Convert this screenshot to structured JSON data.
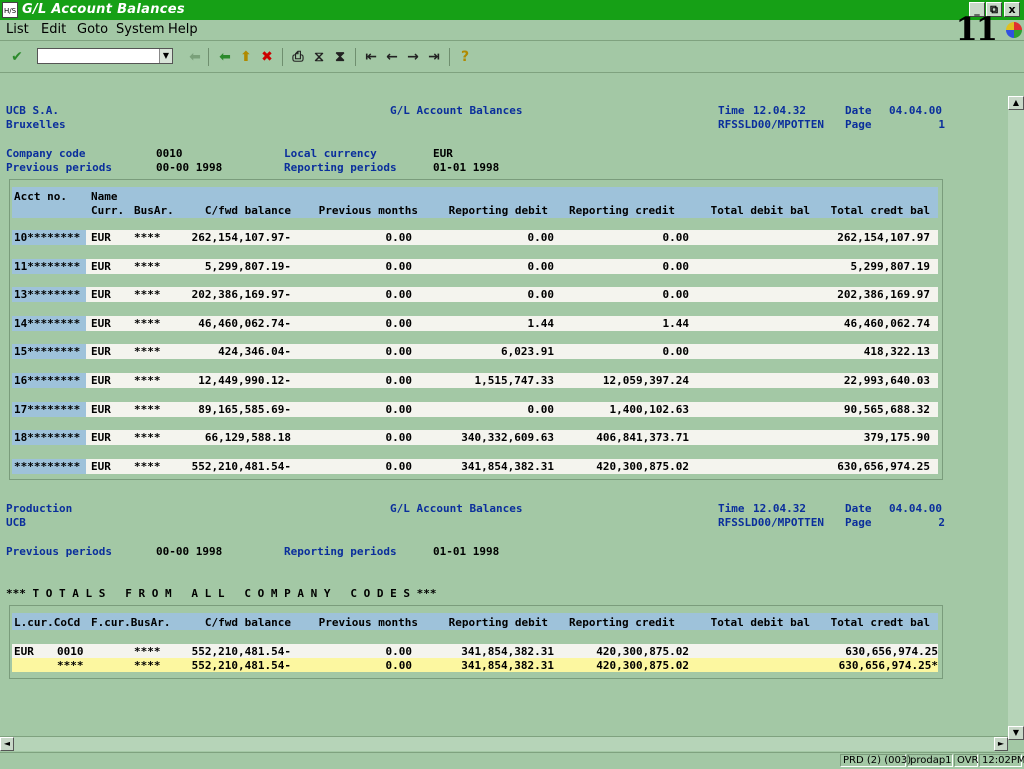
{
  "window": {
    "title": "G/L Account Balances",
    "app_icon": "H/S",
    "system_number": "11",
    "controls": {
      "minimize": "_",
      "restore": "⧉",
      "close": "x"
    }
  },
  "menu": {
    "items": [
      {
        "label": "List"
      },
      {
        "label": "Edit"
      },
      {
        "label": "Goto"
      },
      {
        "label": "System"
      },
      {
        "label": "Help"
      }
    ]
  },
  "toolbar": {
    "command_value": "",
    "icons": [
      "enter-check-icon",
      "back-arrow-icon",
      "exit-up-icon",
      "cancel-x-icon",
      "print-icon",
      "find-icon",
      "find-next-icon",
      "first-page-icon",
      "previous-page-icon",
      "next-page-icon",
      "last-page-icon",
      "help-icon"
    ],
    "glyphs": {
      "enter": "✔",
      "back_disabled": "⬅",
      "back": "⬅",
      "exit": "⬆",
      "cancel": "✖",
      "print": "⎙",
      "find": "⧖",
      "find_next": "⧗",
      "first": "⇤",
      "prev": "←",
      "next": "→",
      "last": "⇥",
      "help": "?"
    },
    "colors": {
      "enter": "#2b8a2b",
      "back": "#2b8a2b",
      "exit": "#b08a00",
      "cancel": "#cc0000",
      "help": "#b08a00"
    }
  },
  "report": {
    "page1": {
      "company": "UCB S.A.",
      "city": "Bruxelles",
      "title": "G/L Account Balances",
      "time_label": "Time",
      "time": "12.04.32",
      "date_label": "Date",
      "date": "04.04.00",
      "program": "RFSSLD00/MPOTTEN",
      "page_label": "Page",
      "page": "1",
      "company_code_label": "Company code",
      "company_code": "0010",
      "local_currency_label": "Local currency",
      "local_currency": "EUR",
      "previous_periods_label": "Previous periods",
      "previous_periods": "00-00 1998",
      "reporting_periods_label": "Reporting periods",
      "reporting_periods": "01-01 1998"
    },
    "table1": {
      "header_row1": [
        "Acct no.",
        "Name"
      ],
      "header_row2": [
        "Curr.",
        "BusAr.",
        "C/fwd balance",
        "Previous months",
        "Reporting debit",
        "Reporting credit",
        "Total debit bal",
        "Total credt bal"
      ],
      "rows": [
        {
          "acct": "10********",
          "curr": "EUR",
          "busar": "****",
          "cfwd": "262,154,107.97-",
          "prev": "0.00",
          "rdebit": "0.00",
          "rcredit": "0.00",
          "tdebit": "",
          "tcredit": "262,154,107.97"
        },
        {
          "acct": "11********",
          "curr": "EUR",
          "busar": "****",
          "cfwd": "5,299,807.19-",
          "prev": "0.00",
          "rdebit": "0.00",
          "rcredit": "0.00",
          "tdebit": "",
          "tcredit": "5,299,807.19"
        },
        {
          "acct": "13********",
          "curr": "EUR",
          "busar": "****",
          "cfwd": "202,386,169.97-",
          "prev": "0.00",
          "rdebit": "0.00",
          "rcredit": "0.00",
          "tdebit": "",
          "tcredit": "202,386,169.97"
        },
        {
          "acct": "14********",
          "curr": "EUR",
          "busar": "****",
          "cfwd": "46,460,062.74-",
          "prev": "0.00",
          "rdebit": "1.44",
          "rcredit": "1.44",
          "tdebit": "",
          "tcredit": "46,460,062.74"
        },
        {
          "acct": "15********",
          "curr": "EUR",
          "busar": "****",
          "cfwd": "424,346.04-",
          "prev": "0.00",
          "rdebit": "6,023.91",
          "rcredit": "0.00",
          "tdebit": "",
          "tcredit": "418,322.13"
        },
        {
          "acct": "16********",
          "curr": "EUR",
          "busar": "****",
          "cfwd": "12,449,990.12-",
          "prev": "0.00",
          "rdebit": "1,515,747.33",
          "rcredit": "12,059,397.24",
          "tdebit": "",
          "tcredit": "22,993,640.03"
        },
        {
          "acct": "17********",
          "curr": "EUR",
          "busar": "****",
          "cfwd": "89,165,585.69-",
          "prev": "0.00",
          "rdebit": "0.00",
          "rcredit": "1,400,102.63",
          "tdebit": "",
          "tcredit": "90,565,688.32"
        },
        {
          "acct": "18********",
          "curr": "EUR",
          "busar": "****",
          "cfwd": "66,129,588.18",
          "prev": "0.00",
          "rdebit": "340,332,609.63",
          "rcredit": "406,841,373.71",
          "tdebit": "",
          "tcredit": "379,175.90"
        },
        {
          "acct": "**********",
          "curr": "EUR",
          "busar": "****",
          "cfwd": "552,210,481.54-",
          "prev": "0.00",
          "rdebit": "341,854,382.31",
          "rcredit": "420,300,875.02",
          "tdebit": "",
          "tcredit": "630,656,974.25"
        }
      ]
    },
    "page2": {
      "company": "Production",
      "city": "UCB",
      "title": "G/L Account Balances",
      "time_label": "Time",
      "time": "12.04.32",
      "date_label": "Date",
      "date": "04.04.00",
      "program": "RFSSLD00/MPOTTEN",
      "page_label": "Page",
      "page": "2",
      "previous_periods_label": "Previous periods",
      "previous_periods": "00-00 1998",
      "reporting_periods_label": "Reporting periods",
      "reporting_periods": "01-01 1998",
      "totals_heading": "*** T O T A L S   F R O M   A L L   C O M P A N Y   C O D E S ***"
    },
    "table2": {
      "header": [
        "L.cur.CoCd",
        "F.cur.BusAr.",
        "C/fwd balance",
        "Previous months",
        "Reporting debit",
        "Reporting credit",
        "Total debit bal",
        "Total credt bal"
      ],
      "rows": [
        {
          "lcur": "EUR",
          "cocd": "0010",
          "fcur": "",
          "busar": "****",
          "cfwd": "552,210,481.54-",
          "prev": "0.00",
          "rdebit": "341,854,382.31",
          "rcredit": "420,300,875.02",
          "tdebit": "",
          "tcredit": "630,656,974.25"
        },
        {
          "lcur": "",
          "cocd": "****",
          "fcur": "",
          "busar": "****",
          "cfwd": "552,210,481.54-",
          "prev": "0.00",
          "rdebit": "341,854,382.31",
          "rcredit": "420,300,875.02",
          "tdebit": "",
          "tcredit": "630,656,974.25*"
        }
      ]
    }
  },
  "scroll": {
    "up": "▲",
    "down": "▼",
    "left": "◄",
    "right": "►"
  },
  "status": {
    "system": "PRD (2) (003)",
    "server": "prodap1",
    "mode": "OVR",
    "time": "12:02PM"
  }
}
